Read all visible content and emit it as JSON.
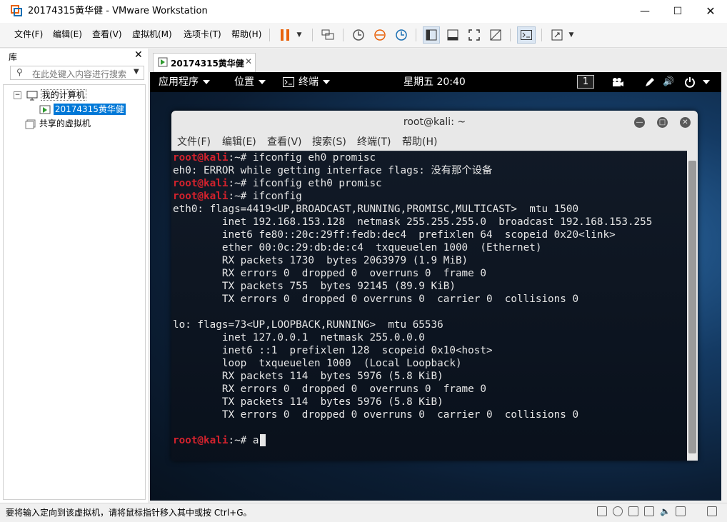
{
  "window": {
    "title": "20174315黄华健 - VMware Workstation"
  },
  "menubar": {
    "items": [
      "文件(F)",
      "编辑(E)",
      "查看(V)",
      "虚拟机(M)",
      "选项卡(T)",
      "帮助(H)"
    ]
  },
  "library": {
    "title": "库",
    "search_placeholder": "在此处键入内容进行搜索",
    "tree": {
      "my_computer": "我的计算机",
      "vm": "20174315黄华健",
      "shared": "共享的虚拟机"
    }
  },
  "tab": {
    "label": "20174315黄华健"
  },
  "gnome": {
    "apps": "应用程序",
    "places": "位置",
    "terminal": "终端",
    "clock": "星期五 20:40",
    "workspace": "1"
  },
  "terminal": {
    "title": "root@kali: ~",
    "menu": [
      "文件(F)",
      "编辑(E)",
      "查看(V)",
      "搜索(S)",
      "终端(T)",
      "帮助(H)"
    ],
    "prompt_user": "root@kali",
    "prompt_tail": ":~#",
    "lines": [
      {
        "prompt": true,
        "text": " ifconfig eh0 promisc"
      },
      {
        "prompt": false,
        "text": "eh0: ERROR while getting interface flags: 没有那个设备"
      },
      {
        "prompt": true,
        "text": " ifconfig eth0 promisc"
      },
      {
        "prompt": true,
        "text": " ifconfig"
      },
      {
        "prompt": false,
        "text": "eth0: flags=4419<UP,BROADCAST,RUNNING,PROMISC,MULTICAST>  mtu 1500"
      },
      {
        "prompt": false,
        "text": "        inet 192.168.153.128  netmask 255.255.255.0  broadcast 192.168.153.255"
      },
      {
        "prompt": false,
        "text": "        inet6 fe80::20c:29ff:fedb:dec4  prefixlen 64  scopeid 0x20<link>"
      },
      {
        "prompt": false,
        "text": "        ether 00:0c:29:db:de:c4  txqueuelen 1000  (Ethernet)"
      },
      {
        "prompt": false,
        "text": "        RX packets 1730  bytes 2063979 (1.9 MiB)"
      },
      {
        "prompt": false,
        "text": "        RX errors 0  dropped 0  overruns 0  frame 0"
      },
      {
        "prompt": false,
        "text": "        TX packets 755  bytes 92145 (89.9 KiB)"
      },
      {
        "prompt": false,
        "text": "        TX errors 0  dropped 0 overruns 0  carrier 0  collisions 0"
      },
      {
        "prompt": false,
        "text": ""
      },
      {
        "prompt": false,
        "text": "lo: flags=73<UP,LOOPBACK,RUNNING>  mtu 65536"
      },
      {
        "prompt": false,
        "text": "        inet 127.0.0.1  netmask 255.0.0.0"
      },
      {
        "prompt": false,
        "text": "        inet6 ::1  prefixlen 128  scopeid 0x10<host>"
      },
      {
        "prompt": false,
        "text": "        loop  txqueuelen 1000  (Local Loopback)"
      },
      {
        "prompt": false,
        "text": "        RX packets 114  bytes 5976 (5.8 KiB)"
      },
      {
        "prompt": false,
        "text": "        RX errors 0  dropped 0  overruns 0  frame 0"
      },
      {
        "prompt": false,
        "text": "        TX packets 114  bytes 5976 (5.8 KiB)"
      },
      {
        "prompt": false,
        "text": "        TX errors 0  dropped 0 overruns 0  carrier 0  collisions 0"
      },
      {
        "prompt": false,
        "text": ""
      },
      {
        "prompt": true,
        "text": " a",
        "cursor": true
      }
    ]
  },
  "statusbar": {
    "message": "要将输入定向到该虚拟机，请将鼠标指针移入其中或按 Ctrl+G。"
  },
  "colors": {
    "prompt": "#d2222d",
    "accent_orange": "#e8620c",
    "selection": "#0078d7"
  }
}
